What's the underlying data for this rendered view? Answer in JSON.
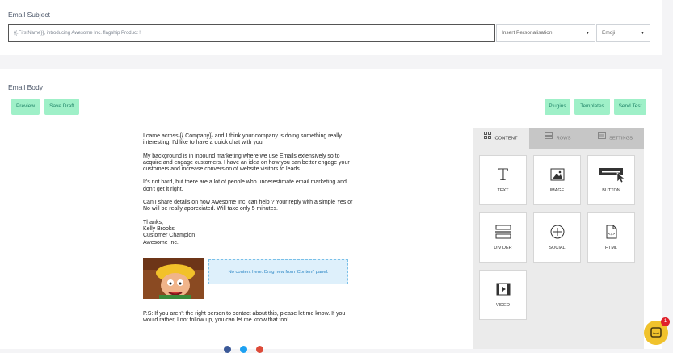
{
  "subject": {
    "label": "Email Subject",
    "value": "{{.FirstName}}, introducing Awesome Inc. flagship Product !",
    "personalisation_label": "Insert Personalisation",
    "emoji_label": "Emoji"
  },
  "body": {
    "label": "Email Body",
    "toolbar": {
      "preview": "Preview",
      "save_draft": "Save Draft",
      "plugins": "Plugins",
      "templates": "Templates",
      "send_test": "Send Test"
    },
    "paragraphs": [
      "I came across {{.Company}} and I think your company is doing something really interesting. I'd like to have a quick chat with you.",
      "My background is in inbound marketing where we use Emails extensively so to acquire and engage customers. I have an idea on how you can better engage your customers and increase conversion of website visitors to leads.",
      "It's not hard, but there are a lot of people who underestimate email marketing and don't get it right.",
      "Can I share details on how Awesome Inc. can help ? Your reply with a simple Yes or No will be really appreciated. Will take only 5 minutes."
    ],
    "signature": [
      "Thanks,",
      "Kelly Brooks",
      "Customer Champion",
      "Awesome Inc."
    ],
    "dropzone_text": "No content here. Drag new from 'Content' panel.",
    "ps": "P.S: If you aren't the right person to contact about this, please let me know. If you would rather, I not follow up, you can let me know that too!"
  },
  "builder": {
    "tabs": {
      "content": "CONTENT",
      "rows": "ROWS",
      "settings": "SETTINGS"
    },
    "tiles": {
      "text": "TEXT",
      "image": "IMAGE",
      "button": "BUTTON",
      "divider": "DIVIDER",
      "social": "SOCIAL",
      "html": "HTML",
      "video": "VIDEO"
    }
  },
  "chat": {
    "badge_count": "1"
  },
  "colors": {
    "accent_btn_bg": "#9ff0c8",
    "accent_btn_text": "#23866a",
    "dropzone": "#def0fb",
    "chat": "#f0c22c"
  }
}
